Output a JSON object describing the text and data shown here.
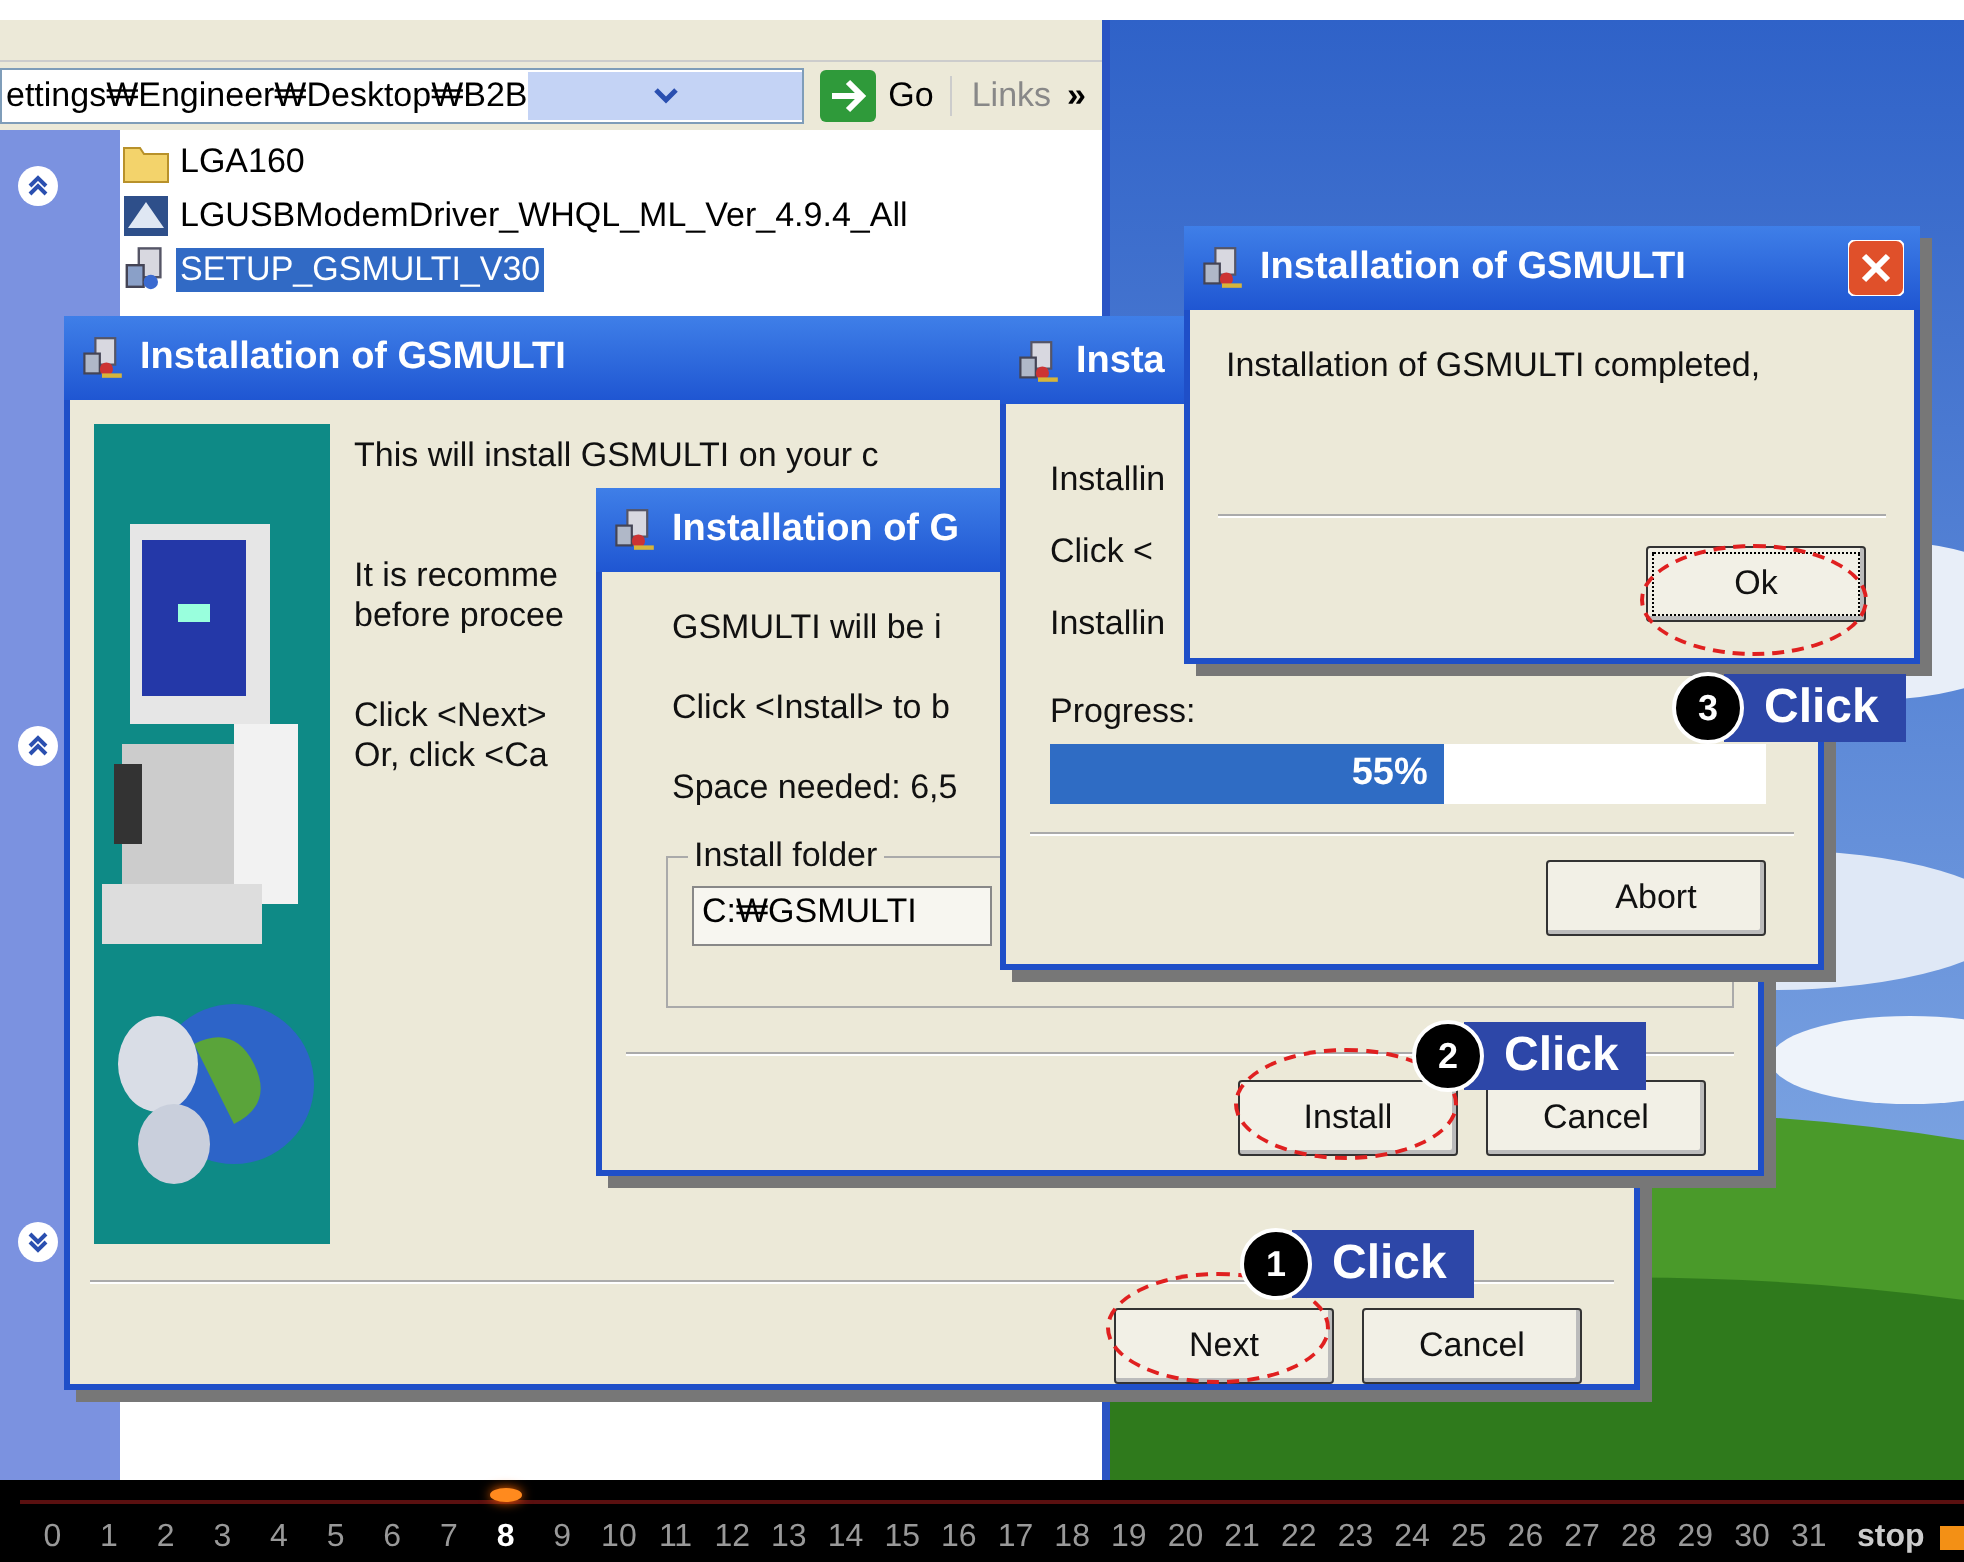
{
  "explorer": {
    "address": "ettings₩Engineer₩Desktop₩B2B",
    "go_button": "Go",
    "links": "Links",
    "more": "»",
    "files": [
      {
        "name": "LGA160",
        "kind": "folder",
        "selected": false
      },
      {
        "name": "LGUSBModemDriver_WHQL_ML_Ver_4.9.4_All",
        "kind": "installer",
        "selected": false
      },
      {
        "name": "SETUP_GSMULTI_V30",
        "kind": "setup",
        "selected": true
      }
    ]
  },
  "setup_window": {
    "title": "Installation of GSMULTI",
    "lines": [
      "This will install GSMULTI on your c",
      "It is recomme",
      "before procee",
      "Click <Next>",
      "Or, click <Ca"
    ],
    "buttons": [
      "Next",
      "Cancel"
    ]
  },
  "install_window": {
    "title": "Installation of G",
    "lines": [
      "GSMULTI will be i",
      "Click <Install> to b",
      "Space needed: 6,5"
    ],
    "folder_label": "Install folder",
    "folder": "C:₩GSMULTI",
    "buttons": [
      "Install",
      "Cancel"
    ]
  },
  "progress_window": {
    "title": "Insta",
    "lines": [
      "Installin",
      "Click <",
      "Installin"
    ],
    "progress_label": "Progress:",
    "level": 0.55,
    "percent": "55%",
    "button": "Abort"
  },
  "complete_dialog": {
    "title": "Installation of GSMULTI",
    "message": "Installation of GSMULTI completed,",
    "button": "Ok"
  },
  "callouts": [
    {
      "number": "1",
      "label": "Click"
    },
    {
      "number": "2",
      "label": "Click"
    },
    {
      "number": "3",
      "label": "Click"
    }
  ],
  "timeline": {
    "steps": [
      {
        "label": "0",
        "selected": false
      },
      {
        "label": "1",
        "selected": false
      },
      {
        "label": "2",
        "selected": false
      },
      {
        "label": "3",
        "selected": false
      },
      {
        "label": "4",
        "selected": false
      },
      {
        "label": "5",
        "selected": false
      },
      {
        "label": "6",
        "selected": false
      },
      {
        "label": "7",
        "selected": false
      },
      {
        "label": "8",
        "selected": true
      },
      {
        "label": "9",
        "selected": false
      },
      {
        "label": "10",
        "selected": false
      },
      {
        "label": "11",
        "selected": false
      },
      {
        "label": "12",
        "selected": false
      },
      {
        "label": "13",
        "selected": false
      },
      {
        "label": "14",
        "selected": false
      },
      {
        "label": "15",
        "selected": false
      },
      {
        "label": "16",
        "selected": false
      },
      {
        "label": "17",
        "selected": false
      },
      {
        "label": "18",
        "selected": false
      },
      {
        "label": "19",
        "selected": false
      },
      {
        "label": "20",
        "selected": false
      },
      {
        "label": "21",
        "selected": false
      },
      {
        "label": "22",
        "selected": false
      },
      {
        "label": "23",
        "selected": false
      },
      {
        "label": "24",
        "selected": false
      },
      {
        "label": "25",
        "selected": false
      },
      {
        "label": "26",
        "selected": false
      },
      {
        "label": "27",
        "selected": false
      },
      {
        "label": "28",
        "selected": false
      },
      {
        "label": "29",
        "selected": false
      },
      {
        "label": "30",
        "selected": false
      },
      {
        "label": "31",
        "selected": false
      }
    ],
    "stop": "stop"
  }
}
